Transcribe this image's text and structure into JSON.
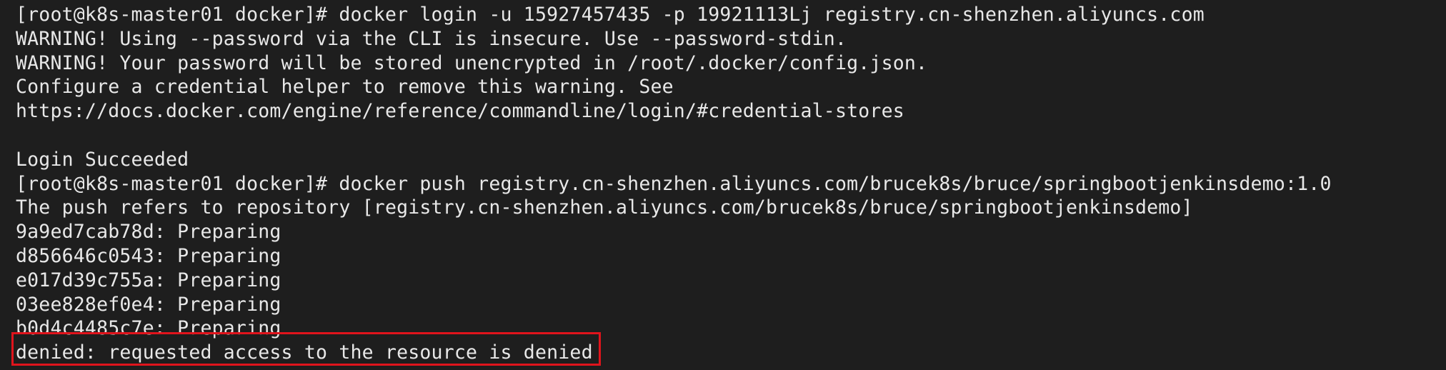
{
  "terminal": {
    "lines": [
      "[root@k8s-master01 docker]# docker login -u 15927457435 -p 19921113Lj registry.cn-shenzhen.aliyuncs.com",
      "WARNING! Using --password via the CLI is insecure. Use --password-stdin.",
      "WARNING! Your password will be stored unencrypted in /root/.docker/config.json.",
      "Configure a credential helper to remove this warning. See",
      "https://docs.docker.com/engine/reference/commandline/login/#credential-stores",
      "",
      "Login Succeeded",
      "[root@k8s-master01 docker]# docker push registry.cn-shenzhen.aliyuncs.com/brucek8s/bruce/springbootjenkinsdemo:1.0",
      "The push refers to repository [registry.cn-shenzhen.aliyuncs.com/brucek8s/bruce/springbootjenkinsdemo]",
      "9a9ed7cab78d: Preparing",
      "d856646c0543: Preparing",
      "e017d39c755a: Preparing",
      "03ee828ef0e4: Preparing",
      "b0d4c4485c7e: Preparing",
      "denied: requested access to the resource is denied"
    ]
  },
  "colors": {
    "background": "#1e1e1e",
    "text": "#e8e8e8",
    "highlight_border": "#e0141c"
  }
}
